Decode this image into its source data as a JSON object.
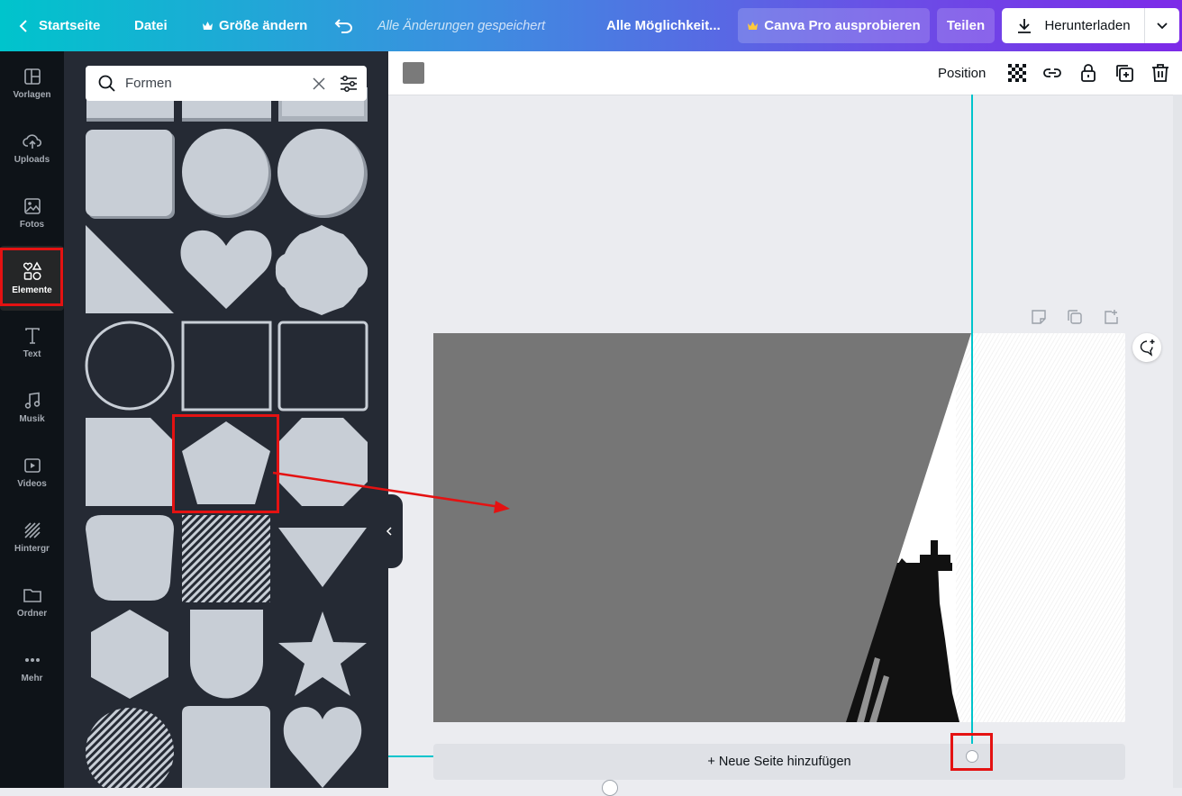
{
  "topbar": {
    "home_label": "Startseite",
    "file_label": "Datei",
    "resize_label": "Größe ändern",
    "saved_status": "Alle Änderungen gespeichert",
    "title": "Alle Möglichkeit...",
    "pro_label": "Canva Pro ausprobieren",
    "share_label": "Teilen",
    "download_label": "Herunterladen"
  },
  "sidebar": {
    "items": [
      {
        "label": "Vorlagen",
        "icon": "templates-icon"
      },
      {
        "label": "Uploads",
        "icon": "upload-cloud-icon"
      },
      {
        "label": "Fotos",
        "icon": "photo-icon"
      },
      {
        "label": "Elemente",
        "icon": "shapes-icon",
        "active": true
      },
      {
        "label": "Text",
        "icon": "text-icon"
      },
      {
        "label": "Musik",
        "icon": "music-note-icon"
      },
      {
        "label": "Videos",
        "icon": "video-icon"
      },
      {
        "label": "Hintergr",
        "icon": "background-pattern-icon"
      },
      {
        "label": "Ordner",
        "icon": "folder-icon"
      },
      {
        "label": "Mehr",
        "icon": "more-dots-icon"
      }
    ]
  },
  "search": {
    "value": "Formen"
  },
  "toolbar": {
    "position_label": "Position",
    "color_swatch": "#7a7a7a"
  },
  "canvas": {
    "add_page_label": "+ Neue Seite hinzufügen"
  },
  "colors": {
    "accent_line": "#00c4cc",
    "highlight": "#e41212",
    "shape_fill": "#c8ced6",
    "panel_bg": "#252a34"
  }
}
